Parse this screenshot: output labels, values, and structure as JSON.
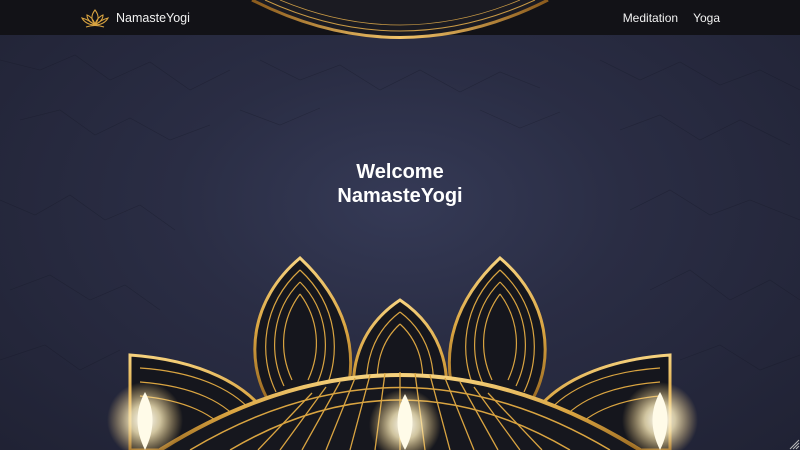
{
  "navbar": {
    "brand": {
      "name": "NamasteYogi",
      "icon": "lotus-icon"
    },
    "links": [
      {
        "label": "Meditation"
      },
      {
        "label": "Yoga"
      }
    ]
  },
  "hero": {
    "title_line1": "Welcome",
    "title_line2": "NamasteYogi"
  },
  "colors": {
    "background": "#2a2d44",
    "navbar": "#121217",
    "gold": "#d9a441",
    "text": "#ffffff"
  },
  "decor": {
    "mandala_icon": "lotus-mandala",
    "candle_icon": "candle-flame-icon"
  }
}
